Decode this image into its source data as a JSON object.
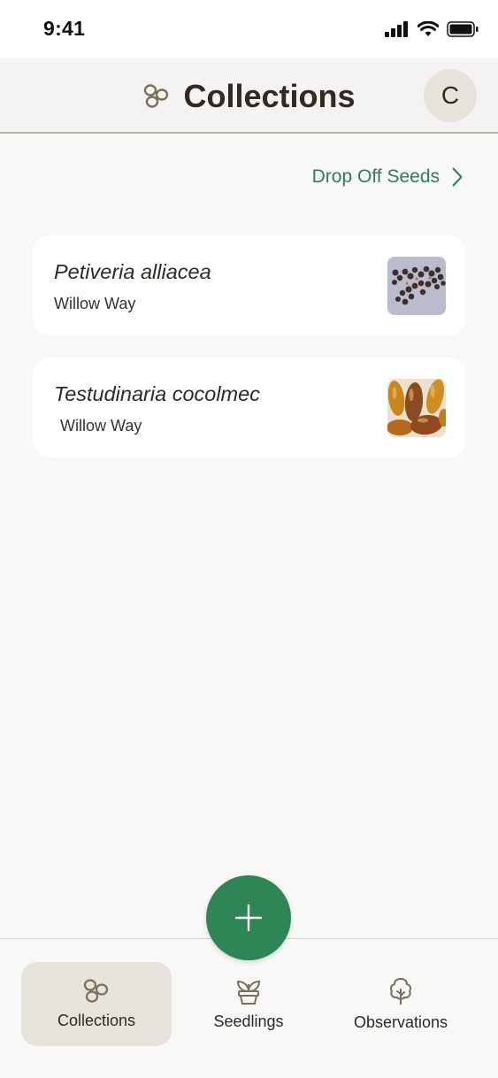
{
  "status_bar": {
    "time": "9:41"
  },
  "header": {
    "title": "Collections",
    "avatar_initial": "C"
  },
  "drop_off": {
    "label": "Drop Off Seeds"
  },
  "collections": [
    {
      "species": "Petiveria alliacea",
      "location": "Willow Way"
    },
    {
      "species": "Testudinaria cocolmec",
      "location": "Willow Way"
    }
  ],
  "tabs": [
    {
      "label": "Collections",
      "active": true
    },
    {
      "label": "Seedlings",
      "active": false
    },
    {
      "label": "Observations",
      "active": false
    }
  ],
  "colors": {
    "accent": "#2e8555",
    "link": "#2e7d53",
    "active_tab": "#e6e3dc",
    "icon": "#7a6f5a"
  }
}
